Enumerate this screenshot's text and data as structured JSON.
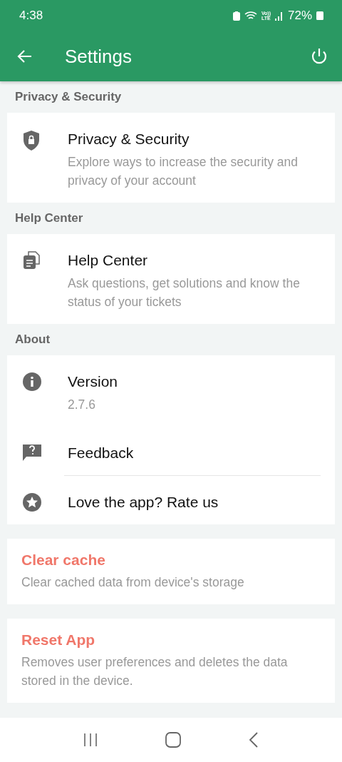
{
  "status_bar": {
    "time": "4:38",
    "network": [
      "Vo))",
      "LTE"
    ],
    "battery": "72%"
  },
  "app_bar": {
    "title": "Settings"
  },
  "sections": [
    {
      "header": "Privacy & Security",
      "items": [
        {
          "kind": "shield",
          "title": "Privacy & Security",
          "subtitle": "Explore ways to increase the security and privacy of your account"
        }
      ]
    },
    {
      "header": "Help Center",
      "items": [
        {
          "kind": "docs",
          "title": "Help Center",
          "subtitle": "Ask questions, get solutions and know the status of your tickets"
        }
      ]
    },
    {
      "header": "About",
      "items": [
        {
          "kind": "info",
          "title": "Version",
          "subtitle": "2.7.6"
        },
        {
          "kind": "feedback",
          "title": "Feedback"
        },
        {
          "kind": "star",
          "title": "Love the app? Rate us"
        }
      ]
    }
  ],
  "actions": [
    {
      "title": "Clear cache",
      "subtitle": "Clear cached data from device's storage"
    },
    {
      "title": "Reset App",
      "subtitle": "Removes user preferences and deletes the data stored in the device."
    }
  ]
}
